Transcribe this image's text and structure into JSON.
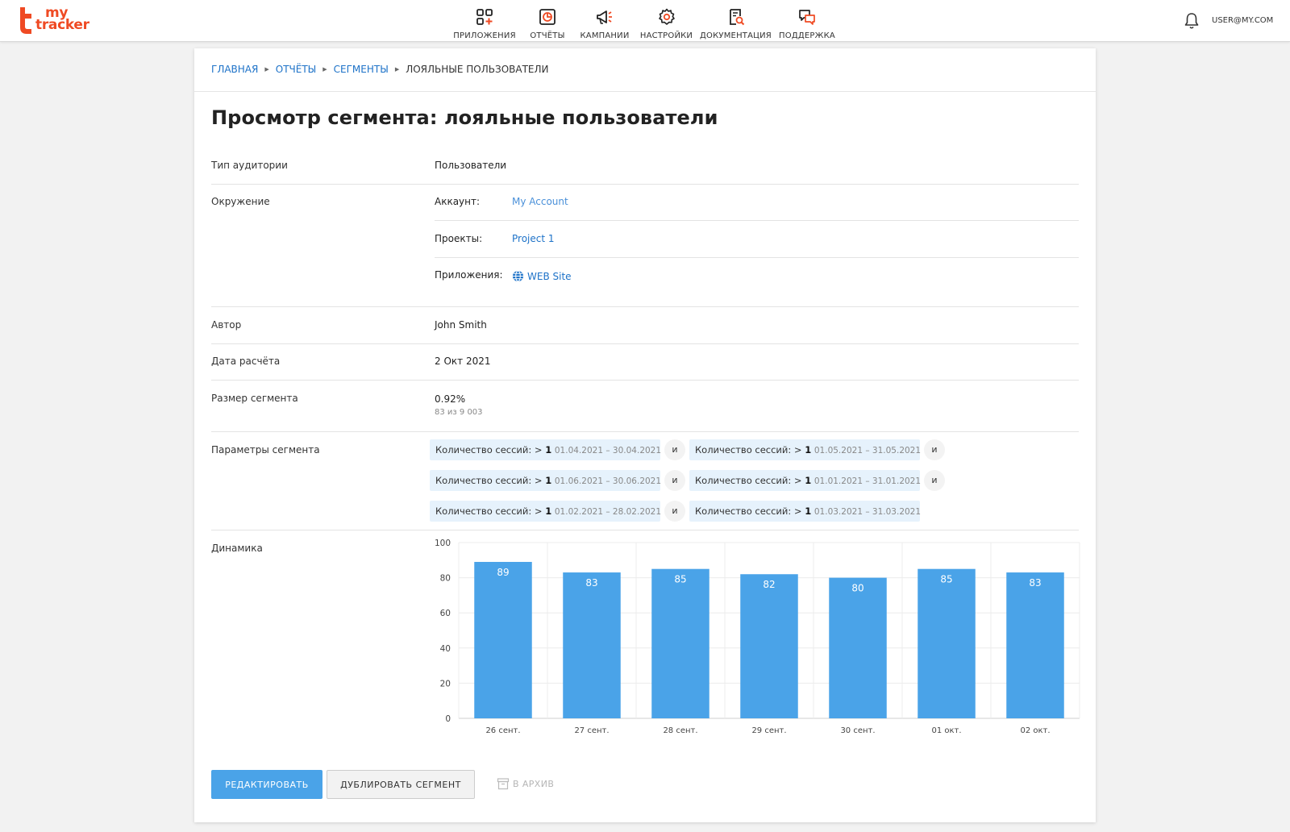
{
  "app": {
    "logo_line1": "my",
    "logo_line2": "tracker",
    "brand_color": "#ef4a23",
    "accent_color": "#4aa3e8",
    "link_color": "#1d72c8"
  },
  "nav": {
    "items": [
      {
        "label": "ПРИЛОЖЕНИЯ",
        "icon": "apps-icon"
      },
      {
        "label": "ОТЧЁТЫ",
        "icon": "reports-icon"
      },
      {
        "label": "КАМПАНИИ",
        "icon": "megaphone-icon"
      },
      {
        "label": "НАСТРОЙКИ",
        "icon": "gear-icon"
      },
      {
        "label": "ДОКУМЕНТАЦИЯ",
        "icon": "documentation-icon"
      },
      {
        "label": "ПОДДЕРЖКА",
        "icon": "support-chat-icon"
      }
    ],
    "notifications_icon": "bell-icon",
    "user": "USER@MY.COM"
  },
  "breadcrumb": {
    "home": "ГЛАВНАЯ",
    "reports": "ОТЧЁТЫ",
    "segments": "СЕГМЕНТЫ",
    "current": "ЛОЯЛЬНЫЕ ПОЛЬЗОВАТЕЛИ"
  },
  "title": "Просмотр сегмента: лояльные пользователи",
  "details": {
    "audience_type": {
      "label": "Тип аудитории",
      "value": "Пользователи"
    },
    "environment": {
      "label": "Окружение",
      "account_label": "Аккаунт:",
      "account_value": "My Account",
      "projects_label": "Проекты:",
      "projects_value": "Project 1",
      "apps_label": "Приложения:",
      "apps_value": "WEB Site",
      "apps_icon": "globe-icon"
    },
    "author": {
      "label": "Автор",
      "value": "John Smith"
    },
    "calc_date": {
      "label": "Дата расчёта",
      "value": "2 Окт 2021"
    },
    "segment_size": {
      "label": "Размер сегмента",
      "value": "0.92%",
      "sub": "83 из 9 003"
    },
    "params": {
      "label": "Параметры сегмента",
      "conjunction": "и",
      "conditions": [
        {
          "text": "Количество сессий: >",
          "num": "1",
          "dates": "01.04.2021 – 30.04.2021"
        },
        {
          "text": "Количество сессий: >",
          "num": "1",
          "dates": "01.05.2021 – 31.05.2021"
        },
        {
          "text": "Количество сессий: >",
          "num": "1",
          "dates": "01.06.2021 – 30.06.2021"
        },
        {
          "text": "Количество сессий: >",
          "num": "1",
          "dates": "01.01.2021 – 31.01.2021"
        },
        {
          "text": "Количество сессий: >",
          "num": "1",
          "dates": "01.02.2021 – 28.02.2021"
        },
        {
          "text": "Количество сессий: >",
          "num": "1",
          "dates": "01.03.2021 – 31.03.2021"
        }
      ]
    },
    "dynamics": {
      "label": "Динамика"
    }
  },
  "chart_data": {
    "type": "bar",
    "categories": [
      "26 сент.",
      "27 сент.",
      "28 сент.",
      "29 сент.",
      "30 сент.",
      "01 окт.",
      "02 окт."
    ],
    "values": [
      89,
      83,
      85,
      82,
      80,
      85,
      83
    ],
    "ylim": [
      0,
      100
    ],
    "yticks": [
      0,
      20,
      40,
      60,
      80,
      100
    ],
    "bar_color": "#4aa3e8",
    "grid": true,
    "data_labels": true
  },
  "actions": {
    "edit": "РЕДАКТИРОВАТЬ",
    "duplicate": "ДУБЛИРОВАТЬ СЕГМЕНТ",
    "archive": "В АРХИВ"
  }
}
